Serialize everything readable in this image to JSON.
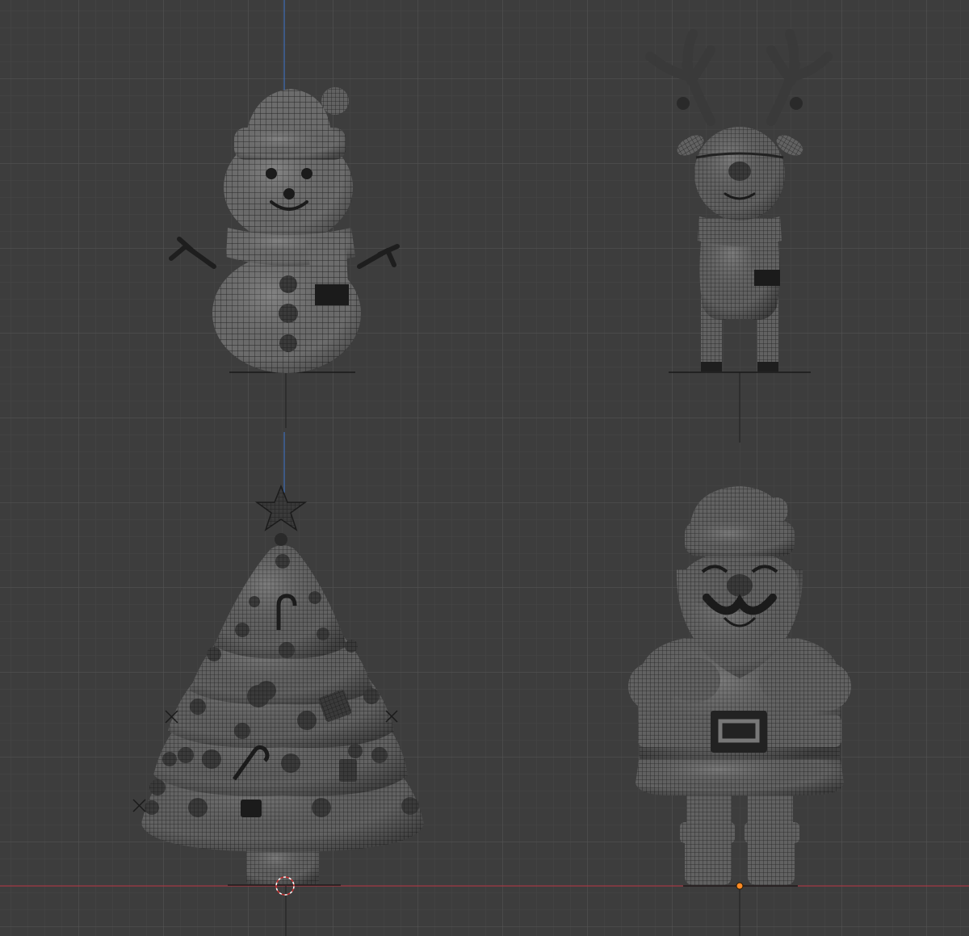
{
  "viewport": {
    "background_color": "#3d3d3d",
    "grid_minor_color": "#474747",
    "grid_major_color": "#525252",
    "axis_x_color": "#a33a44",
    "axis_z_color": "#3f6fb8",
    "mesh_fill_color": "#6c6c6c",
    "mesh_shade_color": "#4a4a4a",
    "wire_color": "#262626",
    "dark_part_color": "#1b1b1b",
    "origin_color": "#ff8a24"
  },
  "objects": [
    {
      "name": "snowman",
      "icon": "snowman-mesh"
    },
    {
      "name": "reindeer",
      "icon": "reindeer-mesh"
    },
    {
      "name": "christmas-tree",
      "icon": "tree-mesh"
    },
    {
      "name": "santa",
      "icon": "santa-mesh"
    }
  ],
  "cursor": {
    "icon": "3d-cursor-icon"
  },
  "origin": {
    "icon": "object-origin-dot"
  }
}
